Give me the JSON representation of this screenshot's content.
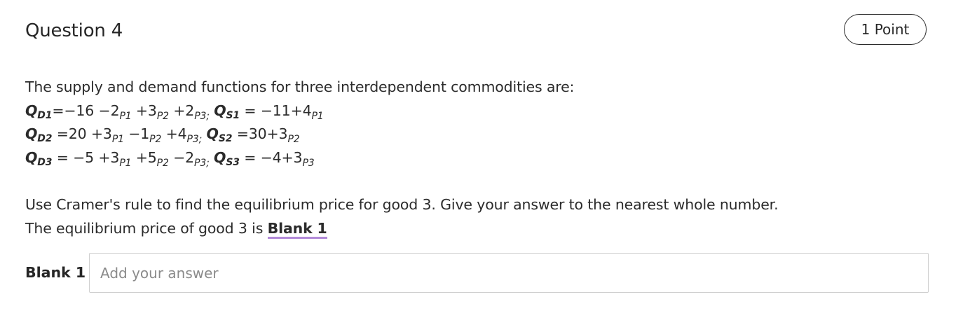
{
  "question": {
    "title": "Question 4",
    "points": "1 Point",
    "intro": "The supply and demand functions for three interdependent commodities are:",
    "equations": [
      {
        "qd": "Q",
        "qd_sub": "D1",
        "d_terms": [
          "=−16 −2",
          "P1",
          " +3",
          "P2",
          " +2",
          "P3;"
        ],
        "qs": "Q",
        "qs_sub": "S1",
        "s_terms": [
          " = −11+4",
          "P1"
        ]
      },
      {
        "qd": "Q",
        "qd_sub": "D2",
        "d_terms": [
          " =20 +3",
          "P1",
          " −1",
          "P2",
          " +4",
          "P3;"
        ],
        "qs": "Q",
        "qs_sub": "S2",
        "s_terms": [
          " =30+3",
          "P2"
        ]
      },
      {
        "qd": "Q",
        "qd_sub": "D3",
        "d_terms": [
          " = −5 +3",
          "P1",
          " +5",
          "P2",
          " −2",
          "P3;"
        ],
        "qs": "Q",
        "qs_sub": "S3",
        "s_terms": [
          " = −4+3",
          "P3"
        ]
      }
    ],
    "instruction": "Use Cramer's rule to find the equilibrium price for good 3. Give your answer to the nearest whole number.",
    "answer_sentence": "The equilibrium price of good 3 is ",
    "blank_ref": "Blank 1"
  },
  "answer": {
    "label": "Blank 1",
    "placeholder": "Add your answer",
    "value": ""
  }
}
